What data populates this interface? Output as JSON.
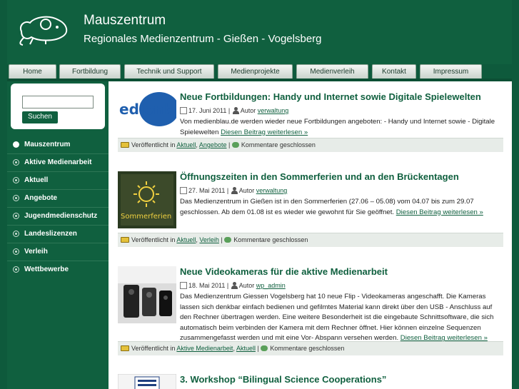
{
  "header": {
    "title": "Mauszentrum",
    "subtitle": "Regionales Medienzentrum - Gießen - Vogelsberg",
    "logo_icon": "mouse-logo-icon"
  },
  "nav": {
    "tabs": [
      "Home",
      "Fortbildung",
      "Technik und Support",
      "Medienprojekte",
      "Medienverleih",
      "Kontakt",
      "Impressum"
    ]
  },
  "search": {
    "value": "",
    "button_label": "Suchen"
  },
  "sidebar": {
    "items": [
      "Mauszentrum",
      "Aktive Medienarbeit",
      "Aktuell",
      "Angebote",
      "Jugendmedienschutz",
      "Landeslizenzen",
      "Verleih",
      "Wettbewerbe"
    ]
  },
  "posts": [
    {
      "title": "Neue Fortbildungen: Handy und Internet sowie Digitale Spielewelten",
      "date": "17. Juni 2011",
      "author_label": "Autor",
      "author": "verwaltung",
      "body": "Von medienblau.de werden wieder neue Fortbildungen angeboten: - Handy und Internet sowie - Digitale Spielewelten",
      "more": "Diesen Beitrag weiterlesen »",
      "thumb_text": "edienbl",
      "published_label": "Veröffentlicht in",
      "categories": [
        "Aktuell",
        "Angebote"
      ],
      "comments": "Kommentare geschlossen"
    },
    {
      "title": "Öffnungszeiten in den Sommerferien und an den Brückentagen",
      "date": "27. Mai 2011",
      "author_label": "Autor",
      "author": "verwaltung",
      "body": "Das Medienzentrum in Gießen ist in den Sommerferien (27.06 – 05.08) vom 04.07 bis zum 29.07 geschlossen. Ab dem 01.08 ist es wieder wie gewohnt für Sie geöffnet.",
      "more": "Diesen Beitrag weiterlesen »",
      "thumb_text": "Sommerferien",
      "published_label": "Veröffentlicht in",
      "categories": [
        "Aktuell",
        "Verleih"
      ],
      "comments": "Kommentare geschlossen"
    },
    {
      "title": "Neue Videokameras für die aktive Medienarbeit",
      "date": "18. Mai 2011",
      "author_label": "Autor",
      "author": "wp_admin",
      "body": "Das Medienzentrum Giessen Vogelsberg hat 10 neue Flip - Videokameras angeschafft. Die Kameras lassen sich denkbar einfach bedienen und gefilmtes Material kann direkt über den USB - Anschluss auf den Rechner übertragen werden. Eine weitere Besonderheit ist die eingebaute Schnittsoftware, die sich automatisch beim verbinden der Kamera mit dem Rechner öffnet. Hier können einzelne Sequenzen zusammengefasst werden und mit eine Vor- Abspann versehen werden.",
      "more": "Diesen Beitrag weiterlesen »",
      "published_label": "Veröffentlicht in",
      "categories": [
        "Aktive Medienarbeit",
        "Aktuell"
      ],
      "comments": "Kommentare geschlossen"
    },
    {
      "title": "3. Workshop “Bilingual Science Cooperations”"
    }
  ],
  "colors": {
    "brand_green": "#10603f",
    "background": "#0e5a3c",
    "footer_bar": "#e7ece8"
  }
}
